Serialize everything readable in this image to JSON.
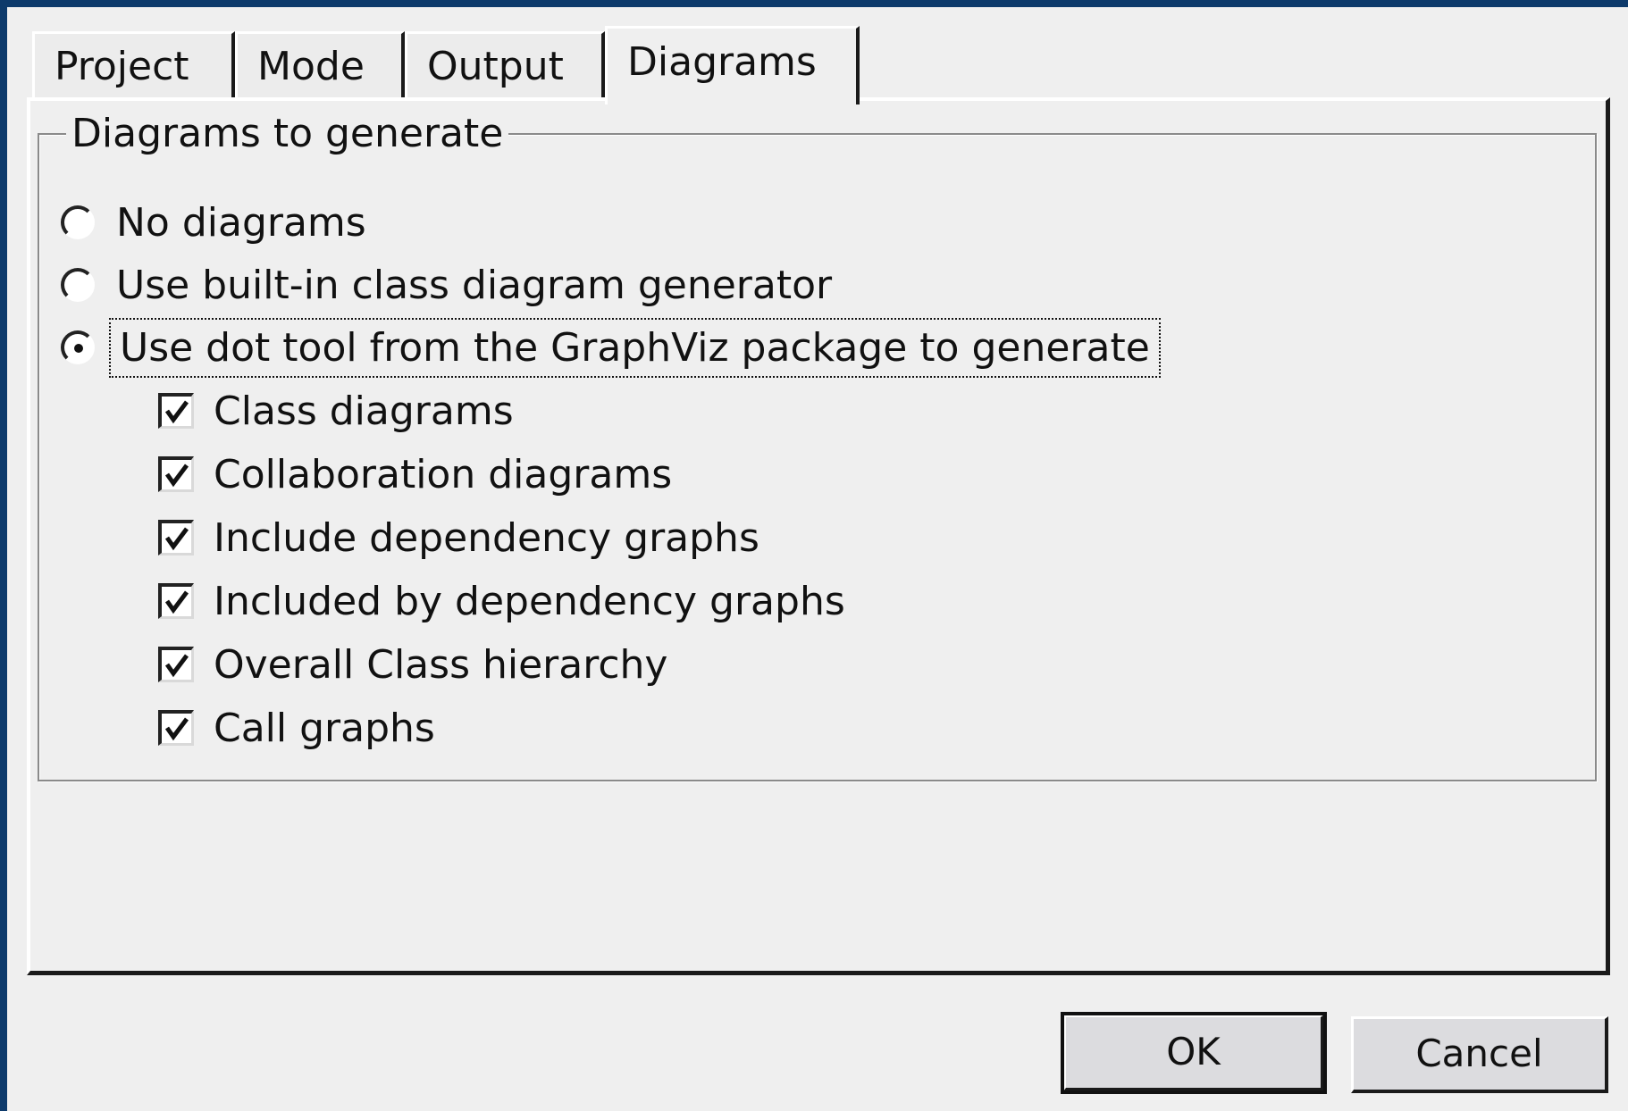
{
  "tabs": [
    {
      "label": "Project",
      "active": false
    },
    {
      "label": "Mode",
      "active": false
    },
    {
      "label": "Output",
      "active": false
    },
    {
      "label": "Diagrams",
      "active": true
    }
  ],
  "group": {
    "title": "Diagrams to generate",
    "radios": [
      {
        "label": "No diagrams",
        "checked": false
      },
      {
        "label": "Use built-in class diagram generator",
        "checked": false
      },
      {
        "label": "Use dot tool from the GraphViz package to generate",
        "checked": true
      }
    ],
    "checkboxes": [
      {
        "label": "Class diagrams",
        "checked": true
      },
      {
        "label": "Collaboration diagrams",
        "checked": true
      },
      {
        "label": "Include dependency graphs",
        "checked": true
      },
      {
        "label": "Included by dependency graphs",
        "checked": true
      },
      {
        "label": "Overall Class hierarchy",
        "checked": true
      },
      {
        "label": "Call graphs",
        "checked": true
      }
    ]
  },
  "buttons": {
    "ok": "OK",
    "cancel": "Cancel"
  }
}
